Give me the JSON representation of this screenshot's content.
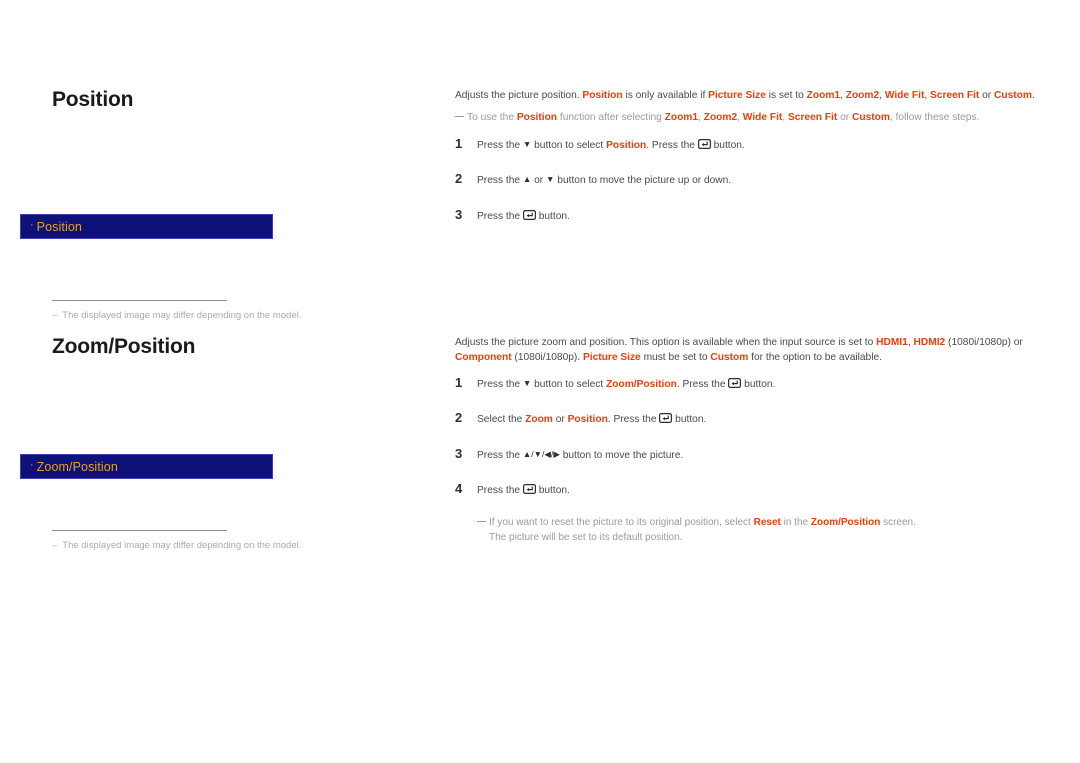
{
  "page": {
    "background": "#ffffff",
    "accent_highlight": "#e8400a",
    "osd_box_bg": "#0d1178",
    "osd_box_border": "#3a3fb5",
    "osd_text_color": "#e8a317",
    "body_text_color": "#4a4a4a",
    "footnote_color": "#a9a9b8"
  },
  "sections": [
    {
      "id": "position",
      "heading": "Position",
      "osd": {
        "bullet": "·",
        "label": "Position"
      },
      "footnote": {
        "dash": "–",
        "text": "The displayed image may differ depending on the model."
      },
      "intro": {
        "part1": "Adjusts the picture position. ",
        "hl1": "Position",
        "part2": " is only available if ",
        "hl2": "Picture Size",
        "part3": " is set to ",
        "hl3": "Zoom1",
        "sep1": ", ",
        "hl4": "Zoom2",
        "sep2": ", ",
        "hl5": "Wide Fit",
        "sep3": ", ",
        "hl6": "Screen Fit",
        "sep4": " or ",
        "hl7": "Custom",
        "part4": "."
      },
      "note": {
        "part1": "To use the ",
        "hl1": "Position",
        "part2": " function after selecting ",
        "hl2": "Zoom1",
        "sep1": ", ",
        "hl3": "Zoom2",
        "sep2": ", ",
        "hl4": "Wide Fit",
        "sep3": ", ",
        "hl5": "Screen Fit",
        "sep4": " or ",
        "hl6": "Custom",
        "part3": ", follow these steps."
      },
      "steps": [
        {
          "num": "1",
          "a": "Press the ",
          "arrow": "▼",
          "b": " button to select ",
          "hl": "Position",
          "c": ". Press the ",
          "icon": "enter-icon",
          "d": " button."
        },
        {
          "num": "2",
          "a": "Press the ",
          "arrow": "▲",
          "b": " or ",
          "arrow2": "▼",
          "c": " button to move the picture up or down.",
          "hl": "",
          "d": ""
        },
        {
          "num": "3",
          "a": "Press the ",
          "icon": "enter-icon",
          "d": " button."
        }
      ]
    },
    {
      "id": "zoomposition",
      "heading": "Zoom/Position",
      "osd": {
        "bullet": "·",
        "label": "Zoom/Position"
      },
      "footnote": {
        "dash": "–",
        "text": "The displayed image may differ depending on the model."
      },
      "intro": {
        "part1": "Adjusts the picture zoom and position. This option is available when the input source is set to ",
        "hl1": "HDMI1",
        "sep1": ", ",
        "hl2": "HDMI2",
        "part2": " (1080i/1080p) or ",
        "hl3": "Component",
        "part3": " (1080i/1080p). ",
        "hl4": "Picture Size",
        "part4": " must be set to ",
        "hl5": "Custom",
        "part5": " for the option to be available."
      },
      "steps": [
        {
          "num": "1",
          "a": "Press the ",
          "arrow": "▼",
          "b": " button to select ",
          "hl": "Zoom/Position",
          "c": ". Press the ",
          "icon": "enter-icon",
          "d": " button."
        },
        {
          "num": "2",
          "a": "Select the ",
          "hl": "Zoom",
          "b": " or ",
          "hl2": "Position",
          "c": ". Press the ",
          "icon": "enter-icon",
          "d": " button."
        },
        {
          "num": "3",
          "a": "Press the ",
          "arrows": "▲/▼/◀/▶",
          "c": " button to move the picture."
        },
        {
          "num": "4",
          "a": "Press the ",
          "icon": "enter-icon",
          "d": " button."
        }
      ],
      "footer_note": {
        "part1": "If you want to reset the picture to its original position, select ",
        "hl1": "Reset",
        "part2": " in the ",
        "hl2": "Zoom/Position",
        "part3": " screen.",
        "line2": "The picture will be set to its default position."
      }
    }
  ]
}
